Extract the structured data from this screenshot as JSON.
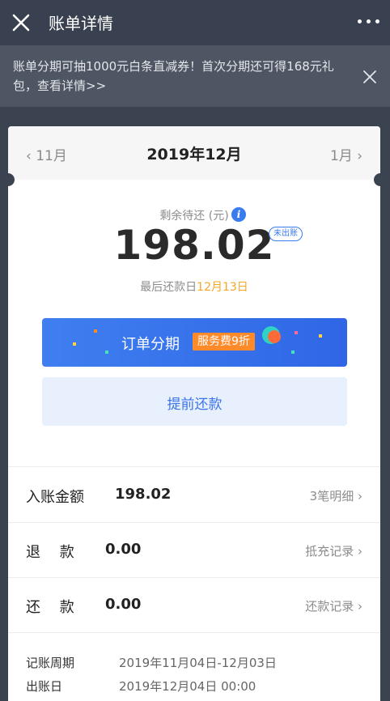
{
  "topbar": {
    "title": "账单详情"
  },
  "banner": {
    "text": "账单分期可抽1000元白条直减券！首次分期还可得168元礼包，查看详情>>"
  },
  "month_nav": {
    "prev": "11月",
    "current": "2019年12月",
    "next": "1月"
  },
  "summary": {
    "label": "剩余待还 (元)",
    "amount": "198.02",
    "status": "未出账",
    "due_prefix": "最后还款日",
    "due_date": "12月13日"
  },
  "actions": {
    "installment_label": "订单分期",
    "installment_tag": "服务费9折",
    "prepay_label": "提前还款"
  },
  "rows": [
    {
      "label": "入账金额",
      "value": "198.02",
      "link": "3笔明细"
    },
    {
      "label": "退　 款",
      "value": "0.00",
      "link": "抵充记录"
    },
    {
      "label": "还　 款",
      "value": "0.00",
      "link": "还款记录"
    }
  ],
  "footer": {
    "period_label": "记账周期",
    "period_value": "2019年11月04日-12月03日",
    "bill_date_label": "出账日",
    "bill_date_value": "2019年12月04日 00:00"
  },
  "colors": {
    "accent": "#3a7cf0",
    "highlight": "#f5a623",
    "tag": "#ff8a2a"
  }
}
